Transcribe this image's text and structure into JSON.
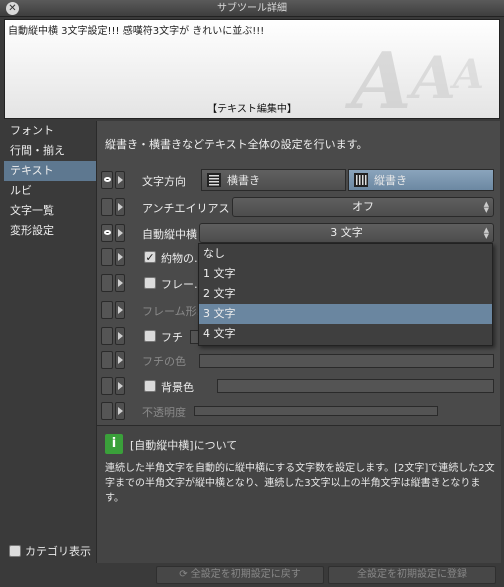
{
  "window": {
    "title": "サブツール詳細",
    "close_glyph": "✕"
  },
  "preview": {
    "sample_text": "自動縦中横 3文字設定!!! 感嘆符3文字が きれいに並ぶ!!!",
    "status": "【テキスト編集中】",
    "watermark": "AAA"
  },
  "sidebar": {
    "items": [
      {
        "label": "フォント"
      },
      {
        "label": "行間・揃え"
      },
      {
        "label": "テキスト"
      },
      {
        "label": "ルビ"
      },
      {
        "label": "文字一覧"
      },
      {
        "label": "変形設定"
      }
    ],
    "selected_index": 2,
    "category_show_label": "カテゴリ表示"
  },
  "main": {
    "description": "縦書き・横書きなどテキスト全体の設定を行います。",
    "direction": {
      "label": "文字方向",
      "horizontal": "横書き",
      "vertical": "縦書き",
      "selected": "vertical"
    },
    "antialias": {
      "label": "アンチエイリアス",
      "value": "オフ"
    },
    "auto_tcy": {
      "label": "自動縦中横",
      "value": "3 文字"
    },
    "yakumono": {
      "label": "約物の…"
    },
    "frame": {
      "label": "フレー…"
    },
    "frame_shape": {
      "label": "フレーム形…"
    },
    "fuchi": {
      "label": "フチ"
    },
    "fuchi_color": {
      "label": "フチの色"
    },
    "background": {
      "label": "背景色"
    },
    "opacity": {
      "label": "不透明度"
    }
  },
  "dropdown": {
    "options": [
      "なし",
      "1 文字",
      "2 文字",
      "3 文字",
      "4 文字"
    ],
    "selected_index": 3
  },
  "info": {
    "icon": "i",
    "title": "[自動縦中横]について",
    "text": "連続した半角文字を自動的に縦中横にする文字数を設定します。[2文字]で連続した2文字までの半角文字が縦中横となり、連続した3文字以上の半角文字は縦書きとなります。"
  },
  "footer": {
    "reset_label": "全設定を初期設定に戻す",
    "register_label": "全設定を初期設定に登録"
  },
  "colors": {
    "selection": "#5e7890",
    "info_icon": "#3aa03a"
  }
}
